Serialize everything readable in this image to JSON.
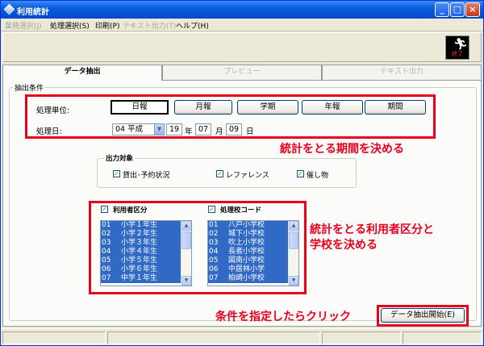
{
  "window": {
    "title": "利用統計"
  },
  "menu": [
    {
      "label": "業務選択(J)",
      "enabled": false
    },
    {
      "label": "処理選択(S)",
      "enabled": true
    },
    {
      "label": "印刷(P)",
      "enabled": true
    },
    {
      "label": "テキスト出力(T)",
      "enabled": false
    },
    {
      "label": "ヘルプ(H)",
      "enabled": true
    }
  ],
  "toolbar": {
    "exit_label": "終了",
    "exit_icon": "running-man-icon"
  },
  "tabs": [
    {
      "label": "データ抽出",
      "active": true
    },
    {
      "label": "プレビュー",
      "active": false
    },
    {
      "label": "テキスト出力",
      "active": false
    }
  ],
  "conditions": {
    "group_label": "抽出条件",
    "unit_label": "処理単位:",
    "unit_buttons": [
      "日報",
      "月報",
      "学期",
      "年報",
      "期間"
    ],
    "unit_selected": "日報",
    "date_label": "処理日:",
    "era": "04 平成",
    "year": "19",
    "year_unit": "年",
    "month": "07",
    "month_unit": "月",
    "day": "09",
    "day_unit": "日"
  },
  "output": {
    "title": "出力対象",
    "items": [
      {
        "label": "貸出･予約状況",
        "checked": true
      },
      {
        "label": "レファレンス",
        "checked": true
      },
      {
        "label": "催し物",
        "checked": true
      }
    ]
  },
  "user_category": {
    "title": "利用者区分",
    "checked": true,
    "items": [
      {
        "code": "01",
        "name": "小学１年生"
      },
      {
        "code": "02",
        "name": "小学２年生"
      },
      {
        "code": "03",
        "name": "小学３年生"
      },
      {
        "code": "04",
        "name": "小学４年生"
      },
      {
        "code": "05",
        "name": "小学５年生"
      },
      {
        "code": "06",
        "name": "小学６年生"
      },
      {
        "code": "07",
        "name": "中学１年生"
      }
    ]
  },
  "school_code": {
    "title": "処理校コード",
    "checked": true,
    "items": [
      {
        "code": "01",
        "name": "八戸小学校"
      },
      {
        "code": "02",
        "name": "城下小学校"
      },
      {
        "code": "03",
        "name": "吹上小学校"
      },
      {
        "code": "04",
        "name": "長者小学校"
      },
      {
        "code": "05",
        "name": "図南小学校"
      },
      {
        "code": "06",
        "name": "中居林小学"
      },
      {
        "code": "07",
        "name": "柏崎小学校"
      }
    ]
  },
  "annotations": {
    "period": "統計をとる期間を決める",
    "category_line1": "統計をとる利用者区分と",
    "category_line2": "学校を決める",
    "click": "条件を指定したらクリック",
    "annotation_color": "#e8001f"
  },
  "start_button": "データ抽出開始(E)"
}
